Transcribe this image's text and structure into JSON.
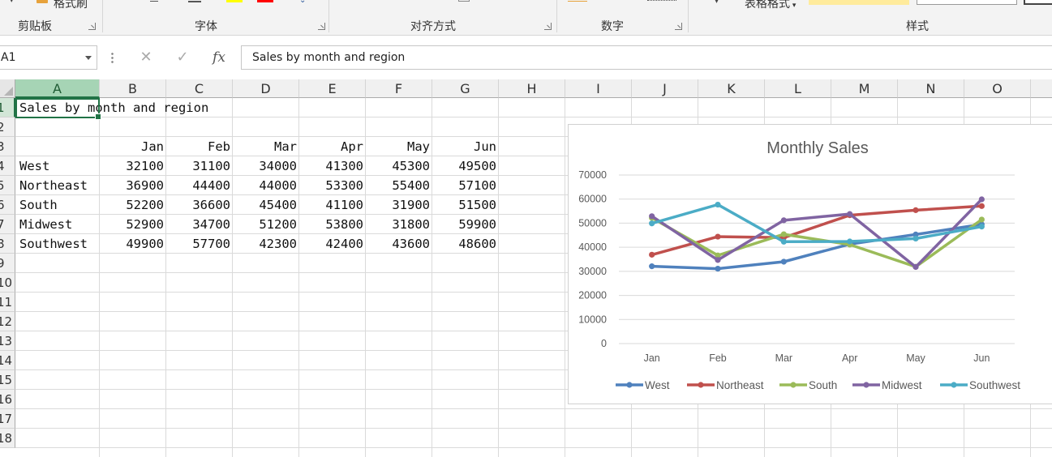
{
  "ribbon": {
    "groups": [
      {
        "label": "剪贴板"
      },
      {
        "label": "字体"
      },
      {
        "label": "对齐方式"
      },
      {
        "label": "数字"
      },
      {
        "label": "样式"
      }
    ],
    "format_painter_label": "格式刷",
    "table_format_label": "表格格式"
  },
  "formula_bar": {
    "name_box": "A1",
    "formula": "Sales by month and region"
  },
  "sheet": {
    "columns": [
      "A",
      "B",
      "C",
      "D",
      "E",
      "F",
      "G",
      "H",
      "I",
      "J",
      "K",
      "L",
      "M",
      "N",
      "O"
    ],
    "rows": [
      "1",
      "2",
      "3",
      "4",
      "5",
      "6",
      "7",
      "8",
      "9",
      "10",
      "11",
      "12",
      "13",
      "14",
      "15",
      "16",
      "17",
      "18"
    ],
    "title_cell": "Sales by month and region",
    "months": [
      "Jan",
      "Feb",
      "Mar",
      "Apr",
      "May",
      "Jun"
    ],
    "regions": [
      {
        "name": "West",
        "values": [
          "32100",
          "31100",
          "34000",
          "41300",
          "45300",
          "49500"
        ]
      },
      {
        "name": "Northeast",
        "values": [
          "36900",
          "44400",
          "44000",
          "53300",
          "55400",
          "57100"
        ]
      },
      {
        "name": "South",
        "values": [
          "52200",
          "36600",
          "45400",
          "41100",
          "31900",
          "51500"
        ]
      },
      {
        "name": "Midwest",
        "values": [
          "52900",
          "34700",
          "51200",
          "53800",
          "31800",
          "59900"
        ]
      },
      {
        "name": "Southwest",
        "values": [
          "49900",
          "57700",
          "42300",
          "42400",
          "43600",
          "48600"
        ]
      }
    ]
  },
  "chart_data": {
    "type": "line",
    "title": "Monthly Sales",
    "categories": [
      "Jan",
      "Feb",
      "Mar",
      "Apr",
      "May",
      "Jun"
    ],
    "ylim": [
      0,
      70000
    ],
    "yticks": [
      "0",
      "10000",
      "20000",
      "30000",
      "40000",
      "50000",
      "60000",
      "70000"
    ],
    "grid": true,
    "legend": "bottom",
    "series": [
      {
        "name": "West",
        "color": "#4f81bd",
        "values": [
          32100,
          31100,
          34000,
          41300,
          45300,
          49500
        ]
      },
      {
        "name": "Northeast",
        "color": "#c0504d",
        "values": [
          36900,
          44400,
          44000,
          53300,
          55400,
          57100
        ]
      },
      {
        "name": "South",
        "color": "#9bbb59",
        "values": [
          52200,
          36600,
          45400,
          41100,
          31900,
          51500
        ]
      },
      {
        "name": "Midwest",
        "color": "#8064a2",
        "values": [
          52900,
          34700,
          51200,
          53800,
          31800,
          59900
        ]
      },
      {
        "name": "Southwest",
        "color": "#4bacc6",
        "values": [
          49900,
          57700,
          42300,
          42400,
          43600,
          48600
        ]
      }
    ]
  }
}
